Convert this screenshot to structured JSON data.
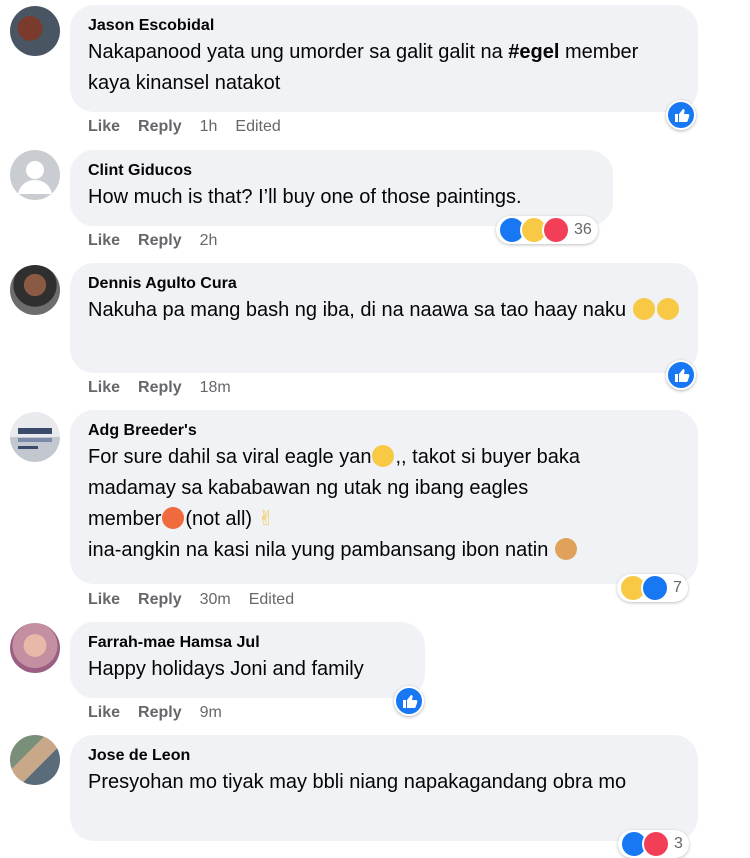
{
  "comments": [
    {
      "name": "Jason Escobidal",
      "text_before": "Nakapanood yata ung umorder sa galit galit na ",
      "text_bold": "#egel",
      "text_after": " member kaya kinansel natakot",
      "actions": {
        "like": "Like",
        "reply": "Reply",
        "time": "1h",
        "edited": "Edited"
      }
    },
    {
      "name": "Clint Giducos",
      "text": "How much is that? I’ll buy one of those paintings.",
      "actions": {
        "like": "Like",
        "reply": "Reply",
        "time": "2h"
      },
      "reactions": {
        "icons": [
          "like-icon",
          "wow-icon",
          "care-icon"
        ],
        "count": "36"
      }
    },
    {
      "name": "Dennis Agulto Cura",
      "text": "Nakuha pa mang bash ng iba, di na naawa sa tao haay naku",
      "emojis": [
        "flushed-emoji-icon",
        "rolling-eyes-emoji-icon"
      ],
      "actions": {
        "like": "Like",
        "reply": "Reply",
        "time": "18m"
      }
    },
    {
      "name": "Adg Breeder's",
      "line1": "For sure dahil sa viral eagle yan",
      "line1_tail": ",, takot si buyer baka",
      "line2": "madamay sa kababawan ng utak ng ibang eagles",
      "line3_a": "member",
      "line3_b": "(not all)",
      "line4": "ina-angkin na kasi nila yung pambansang ibon natin",
      "actions": {
        "like": "Like",
        "reply": "Reply",
        "time": "30m",
        "edited": "Edited"
      },
      "reactions": {
        "icons": [
          "haha-icon",
          "like-icon"
        ],
        "count": "7"
      }
    },
    {
      "name": "Farrah-mae Hamsa Jul",
      "text": "Happy holidays Joni and family",
      "actions": {
        "like": "Like",
        "reply": "Reply",
        "time": "9m"
      }
    },
    {
      "name": "Jose de Leon",
      "text": "Presyohan mo tiyak may bbli niang napakagandang obra mo",
      "reactions": {
        "icons": [
          "like-icon",
          "care-icon"
        ],
        "count": "3"
      }
    }
  ],
  "colors": {
    "bubble": "#f0f2f5",
    "meta": "#65676b",
    "like_blue": "#1877f2"
  }
}
